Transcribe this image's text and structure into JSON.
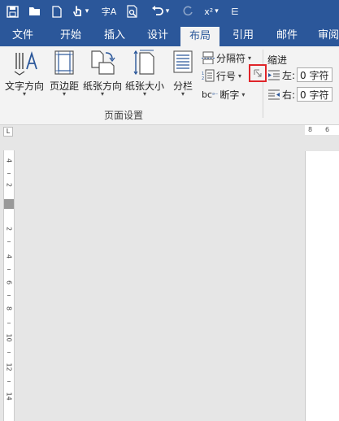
{
  "qat": {
    "save_icon": "save-icon",
    "open_icon": "open-folder-icon",
    "new_icon": "new-document-icon",
    "touch_icon": "touch-mode-icon",
    "spelling_icon": "spelling-check-icon",
    "print_preview_icon": "print-preview-icon",
    "undo_icon": "undo-icon",
    "redo_icon": "redo-icon",
    "subscript_icon": "subscript-icon",
    "customize_icon": "customize-qat-icon",
    "spelling_glyph": "字A",
    "subscript_glyph": "x²"
  },
  "tabs": [
    "文件",
    "开始",
    "插入",
    "设计",
    "布局",
    "引用",
    "邮件",
    "审阅"
  ],
  "active_tab": "布局",
  "page_setup": {
    "group_label": "页面设置",
    "text_direction": "文字方向",
    "margins": "页边距",
    "orientation": "纸张方向",
    "size": "纸张大小",
    "columns": "分栏",
    "breaks": "分隔符",
    "line_numbers": "行号",
    "hyphenation": "断字",
    "hyphenation_prefix": "bc"
  },
  "indent": {
    "title": "缩进",
    "left_label": "左:",
    "left_value": "0 字符",
    "right_label": "右:",
    "right_value": "0 字符"
  },
  "ruler": {
    "h_numbers": [
      "8",
      "6"
    ],
    "v_numbers": [
      "4",
      "2",
      "2",
      "4",
      "6",
      "8",
      "10",
      "12",
      "14"
    ],
    "tab_selector": "L"
  },
  "colors": {
    "ribbon_blue": "#2b579a",
    "ribbon_bg": "#f3f3f3",
    "highlight": "#e0252a"
  }
}
